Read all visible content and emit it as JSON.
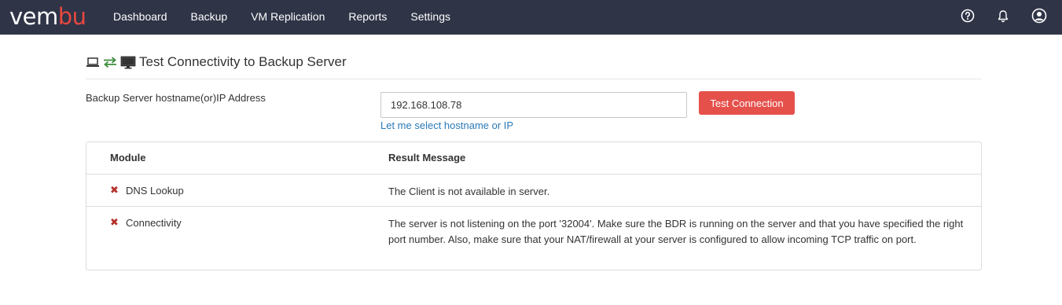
{
  "app": {
    "logo_prefix": "vem",
    "logo_accent": "bu"
  },
  "nav": {
    "items": [
      "Dashboard",
      "Backup",
      "VM Replication",
      "Reports",
      "Settings"
    ]
  },
  "header_icons": [
    "help-icon",
    "bell-icon",
    "user-icon"
  ],
  "page": {
    "title": "Test Connectivity to Backup Server",
    "icons": [
      "laptop-icon",
      "exchange-arrows-icon",
      "monitor-icon"
    ]
  },
  "form": {
    "label": "Backup Server hostname(or)IP Address",
    "host_value": "192.168.108.78",
    "button_label": "Test Connection",
    "link_label": "Let me select hostname or IP"
  },
  "table": {
    "headers": [
      "Module",
      "Result Message"
    ],
    "rows": [
      {
        "module": "DNS Lookup",
        "status": "fail",
        "message": "The Client is not available in server."
      },
      {
        "module": "Connectivity",
        "status": "fail",
        "message": "The server is not listening on the port '32004'. Make sure the BDR is running on the server and that you have specified the right port number. Also, make sure that your NAT/firewall at your server is configured to allow incoming TCP traffic on port."
      }
    ]
  },
  "colors": {
    "topbar": "#2f3447",
    "accent": "#e5504b",
    "link": "#2a7ab8",
    "fail": "#b5312c",
    "arrows": "#3c8c3c"
  }
}
